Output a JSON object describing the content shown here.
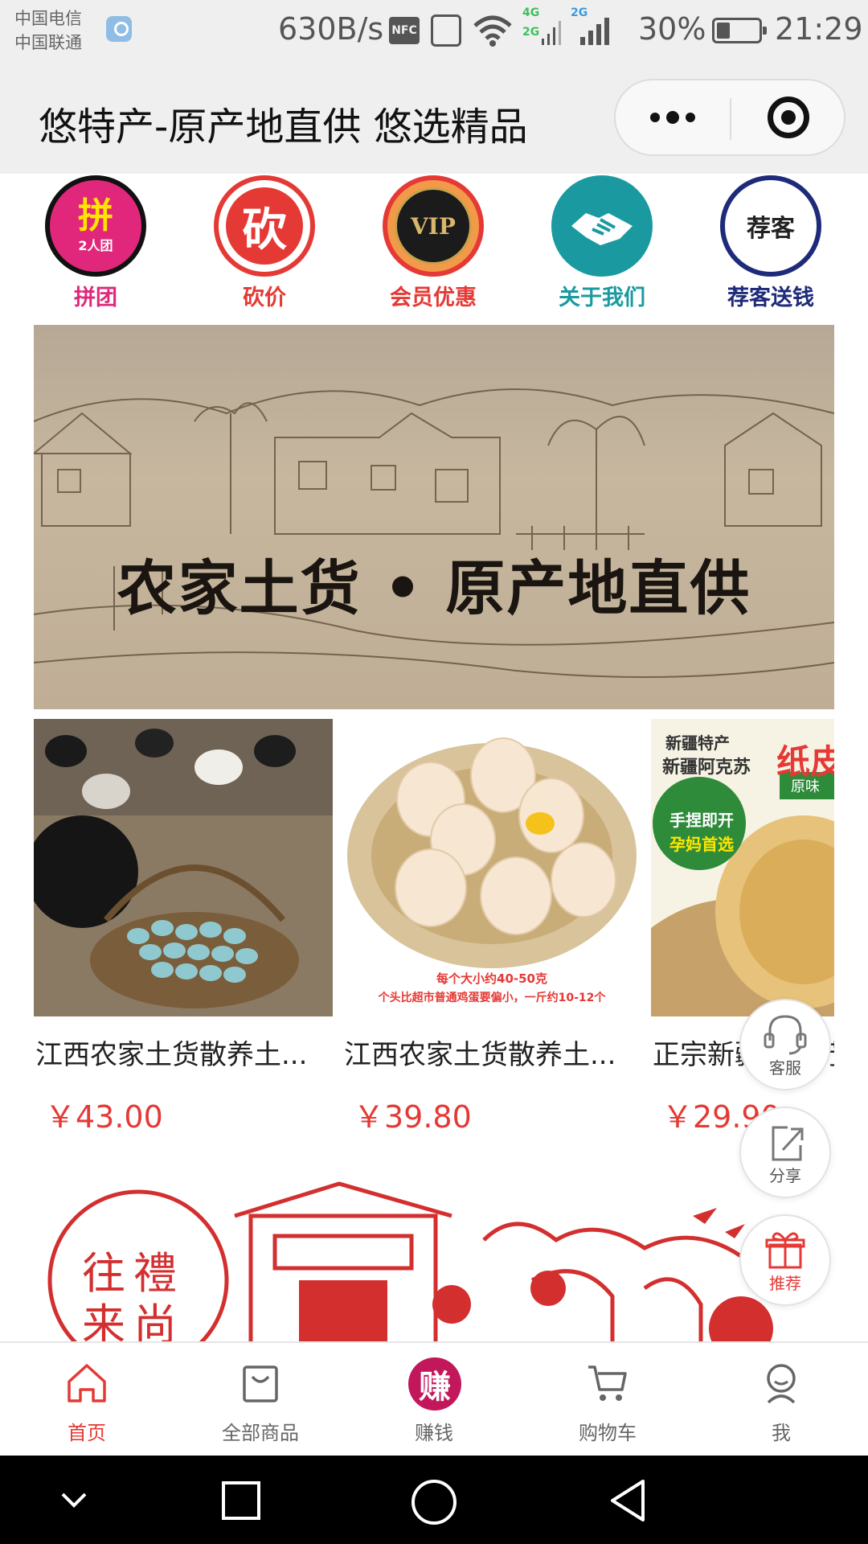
{
  "status_bar": {
    "carrier_1": "中国电信",
    "carrier_2": "中国联通",
    "net_speed": "630B/s",
    "nfc": "NFC",
    "signal_1_label": "4G",
    "signal_1b_label": "2G",
    "signal_2_label": "2G",
    "battery": "30%",
    "time": "21:29"
  },
  "header": {
    "title": "悠特产-原产地直供 悠选精品"
  },
  "quick_nav": [
    {
      "label": "拼团",
      "badge": "拼",
      "badge_sub": "2人团",
      "color": "#e0277b"
    },
    {
      "label": "砍价",
      "badge": "砍",
      "color": "#e53935"
    },
    {
      "label": "会员优惠",
      "badge": "VIP",
      "color": "#e53935"
    },
    {
      "label": "关于我们",
      "badge": "",
      "color": "#1a9aa0"
    },
    {
      "label": "荐客送钱",
      "badge": "荐客",
      "color": "#1e2a7a"
    }
  ],
  "banner": {
    "text": "农家土货 • 原产地直供"
  },
  "products": [
    {
      "title": "江西农家土货散养土...",
      "price": "￥43.00"
    },
    {
      "title": "江西农家土货散养土...",
      "price": "￥39.80",
      "img_caption_1": "每个大小约40-50克",
      "img_caption_2": "个头比超市普通鸡蛋要偏小，一斤约10-12个"
    },
    {
      "title": "正宗新疆阿克苏...",
      "price": "￥29.90",
      "img_tag_1": "新疆特产",
      "img_tag_2": "新疆阿克苏",
      "img_tag_3": "纸皮",
      "img_tag_4": "原味",
      "img_tag_5": "手捏即开",
      "img_tag_6": "孕妈首选"
    }
  ],
  "float_buttons": [
    {
      "label": "客服"
    },
    {
      "label": "分享"
    },
    {
      "label": "推荐"
    }
  ],
  "festival_banner": {
    "text": "往禮来尚"
  },
  "tabbar": [
    {
      "label": "首页",
      "active": true
    },
    {
      "label": "全部商品",
      "active": false
    },
    {
      "label": "赚钱",
      "active": false,
      "badge": "赚"
    },
    {
      "label": "购物车",
      "active": false
    },
    {
      "label": "我",
      "active": false
    }
  ],
  "colors": {
    "accent": "#e53935",
    "bg_header": "#efefef"
  }
}
